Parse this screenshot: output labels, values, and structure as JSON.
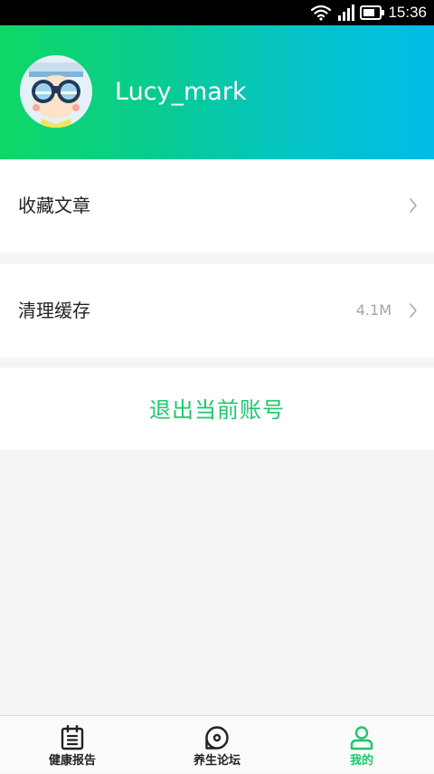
{
  "status_bar": {
    "time": "15:36",
    "icons": [
      "wifi-icon",
      "signal-icon",
      "battery-icon"
    ]
  },
  "profile": {
    "username": "Lucy_mark",
    "avatar": "avatar-icon"
  },
  "menu": {
    "favorites_label": "收藏文章",
    "clear_cache_label": "清理缓存",
    "cache_size": "4.1M",
    "logout_label": "退出当前账号"
  },
  "tabs": [
    {
      "label": "健康报告",
      "icon": "report-icon",
      "active": false
    },
    {
      "label": "养生论坛",
      "icon": "forum-icon",
      "active": false
    },
    {
      "label": "我的",
      "icon": "profile-icon",
      "active": true
    }
  ],
  "colors": {
    "accent": "#1cc86a",
    "header_gradient_start": "#0fd866",
    "header_gradient_end": "#03bbe9",
    "background": "#f4f5f5"
  }
}
